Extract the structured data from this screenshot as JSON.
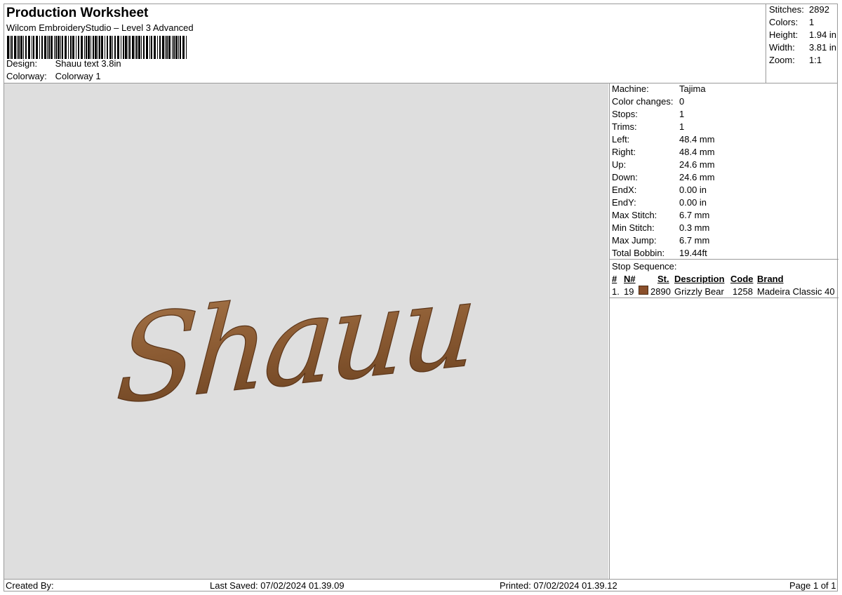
{
  "header": {
    "title": "Production Worksheet",
    "software": "Wilcom EmbroideryStudio – Level 3 Advanced",
    "design_label": "Design:",
    "design_value": "Shauu text 3.8in",
    "colorway_label": "Colorway:",
    "colorway_value": "Colorway 1"
  },
  "summary": {
    "stitches_label": "Stitches:",
    "stitches_value": "2892",
    "colors_label": "Colors:",
    "colors_value": "1",
    "height_label": "Height:",
    "height_value": "1.94 in",
    "width_label": "Width:",
    "width_value": "3.81 in",
    "zoom_label": "Zoom:",
    "zoom_value": "1:1"
  },
  "design_preview": {
    "text": "Shauu",
    "thread_color": "#8a5a32"
  },
  "properties": [
    {
      "label": "Machine:",
      "value": "Tajima"
    },
    {
      "label": "Color changes:",
      "value": "0"
    },
    {
      "label": "Stops:",
      "value": "1"
    },
    {
      "label": "Trims:",
      "value": "1"
    },
    {
      "label": "Left:",
      "value": "48.4 mm"
    },
    {
      "label": "Right:",
      "value": "48.4 mm"
    },
    {
      "label": "Up:",
      "value": "24.6 mm"
    },
    {
      "label": "Down:",
      "value": "24.6 mm"
    },
    {
      "label": "EndX:",
      "value": "0.00 in"
    },
    {
      "label": "EndY:",
      "value": "0.00 in"
    },
    {
      "label": "Max Stitch:",
      "value": "6.7 mm"
    },
    {
      "label": "Min Stitch:",
      "value": "0.3 mm"
    },
    {
      "label": "Max Jump:",
      "value": "6.7 mm"
    },
    {
      "label": "Total Bobbin:",
      "value": "19.44ft"
    }
  ],
  "stop_sequence": {
    "title": "Stop Sequence:",
    "columns": [
      "#",
      "N#",
      "St.",
      "Description",
      "Code",
      "Brand"
    ],
    "rows": [
      {
        "index": "1.",
        "needle": "19",
        "color": "#8a4f2a",
        "stitches": "2890",
        "description": "Grizzly Bear",
        "code": "1258",
        "brand": "Madeira Classic 40"
      }
    ]
  },
  "footer": {
    "created_by": "Created By:",
    "last_saved": "Last Saved: 07/02/2024 01.39.09",
    "printed": "Printed: 07/02/2024 01.39.12",
    "page": "Page 1 of 1"
  }
}
